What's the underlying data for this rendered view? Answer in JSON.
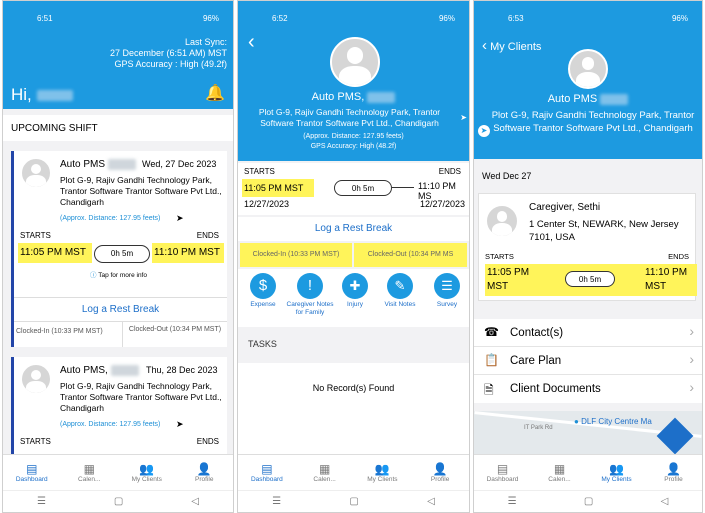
{
  "screen1": {
    "status": {
      "time": "6:51",
      "battery": "96%"
    },
    "header": {
      "last_sync_label": "Last Sync:",
      "last_sync_value": "27 December (6:51 AM) MST",
      "gps": "GPS Accuracy : High (49.2f)",
      "greeting": "Hi,"
    },
    "section_title": "UPCOMING SHIFT",
    "shift1": {
      "client": "Auto PMS",
      "date": "Wed, 27 Dec 2023",
      "address": "Plot G-9, Rajiv Gandhi Technology Park, Trantor Software Trantor Software Pvt Ltd., Chandigarh",
      "distance": "(Approx. Distance: 127.95 feets)",
      "starts_label": "STARTS",
      "ends_label": "ENDS",
      "start_time": "11:05 PM MST",
      "duration": "0h 5m",
      "end_time": "11:10 PM MST",
      "tap_info": "Tap for more info",
      "rest_break": "Log a Rest Break",
      "clocked_in": "Clocked-In (10:33 PM MST)",
      "clocked_out": "Clocked-Out (10:34 PM MST)"
    },
    "shift2": {
      "client": "Auto PMS,",
      "date": "Thu, 28 Dec 2023",
      "address": "Plot G-9, Rajiv Gandhi Technology Park, Trantor Software Trantor Software Pvt Ltd., Chandigarh",
      "distance": "(Approx. Distance: 127.95 feets)",
      "starts_label": "STARTS",
      "ends_label": "ENDS"
    },
    "tabs": [
      "Dashboard",
      "Calen...",
      "My Clients",
      "Profile"
    ]
  },
  "screen2": {
    "status": {
      "time": "6:52",
      "battery": "96%"
    },
    "client": "Auto PMS,",
    "address": "Plot G-9, Rajiv Gandhi Technology Park, Trantor Software Trantor Software Pvt Ltd., Chandigarh",
    "distance": "(Approx. Distance: 127.95 feets)",
    "gps": "GPS Accuracy: High (48.2f)",
    "starts_label": "STARTS",
    "ends_label": "ENDS",
    "start_time": "11:05 PM MST",
    "duration": "0h 5m",
    "end_time": "11:10 PM MS",
    "start_date": "12/27/2023",
    "end_date": "12/27/2023",
    "rest_break": "Log a Rest Break",
    "clocked_in": "Clocked-In (10:33 PM MST)",
    "clocked_out": "Clocked-Out (10:34 PM MS",
    "actions": [
      "Expense",
      "Caregiver Notes for Family",
      "Injury",
      "Visit Notes",
      "Survey"
    ],
    "tasks_title": "TASKS",
    "no_records": "No Record(s) Found",
    "tabs": [
      "Dashboard",
      "Calen...",
      "My Clients",
      "Profile"
    ]
  },
  "screen3": {
    "status": {
      "time": "6:53",
      "battery": "96%"
    },
    "back_label": "My Clients",
    "client": "Auto PMS",
    "address": "Plot G-9, Rajiv Gandhi Technology Park, Trantor Software Trantor Software Pvt Ltd., Chandigarh",
    "date_header": "Wed Dec 27",
    "caregiver": "Caregiver, Sethi",
    "caregiver_address": "1 Center St, NEWARK, New Jersey 7101, USA",
    "starts_label": "STARTS",
    "ends_label": "ENDS",
    "start_time": "11:05 PM MST",
    "duration": "0h 5m",
    "end_time": "11:10 PM MST",
    "menu": [
      "Contact(s)",
      "Care Plan",
      "Client Documents"
    ],
    "map_label": "DLF City Centre Ma",
    "map_road": "IT Park Rd",
    "tabs": [
      "Dashboard",
      "Calen...",
      "My Clients",
      "Profile"
    ]
  }
}
